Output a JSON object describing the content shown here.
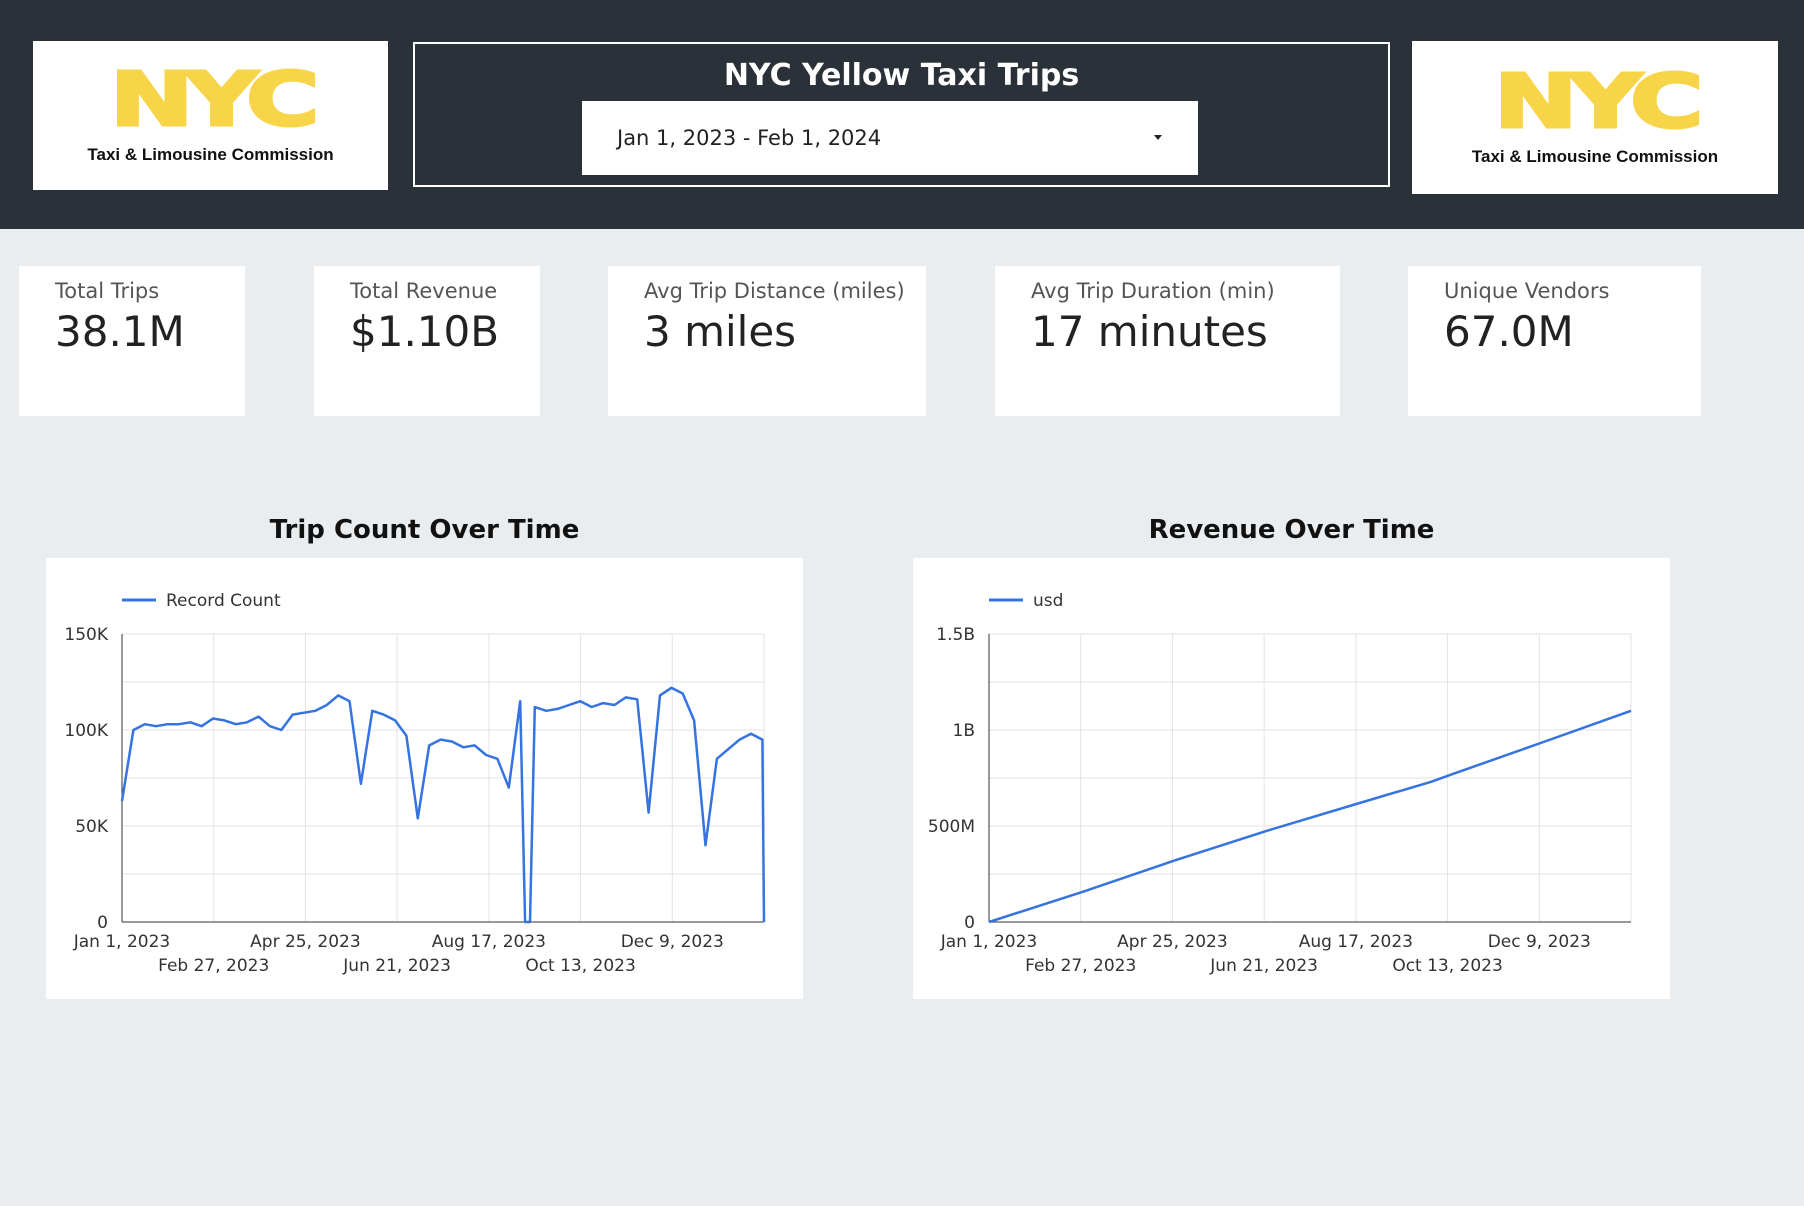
{
  "header": {
    "title": "NYC Yellow Taxi Trips",
    "date_range": "Jan 1, 2023 - Feb 1, 2024",
    "logo_mark": "NYC",
    "logo_subtitle": "Taxi & Limousine Commission",
    "brand_yellow": "#f7d448",
    "background": "#2a3138"
  },
  "kpis": [
    {
      "label": "Total Trips",
      "value": "38.1M"
    },
    {
      "label": "Total Revenue",
      "value": "$1.10B"
    },
    {
      "label": "Avg Trip Distance (miles)",
      "value": "3 miles"
    },
    {
      "label": "Avg Trip Duration (min)",
      "value": "17 minutes"
    },
    {
      "label": "Unique Vendors",
      "value": "67.0M"
    }
  ],
  "chart_data": [
    {
      "type": "line",
      "title": "Trip Count Over Time",
      "legend": "top-left",
      "grid": true,
      "color": "#3573e0",
      "series": [
        {
          "name": "Record Count"
        }
      ],
      "ylim": [
        0,
        150000
      ],
      "y_ticks": [
        "0",
        "50K",
        "100K",
        "150K"
      ],
      "x_ticks_row1": [
        "Jan 1, 2023",
        "Apr 25, 2023",
        "Aug 17, 2023",
        "Dec 9, 2023"
      ],
      "x_ticks_row2": [
        "Feb 27, 2023",
        "Jun 21, 2023",
        "Oct 13, 2023"
      ],
      "x_range": [
        "2023-01-01",
        "2024-01-31"
      ],
      "points": [
        [
          "2023-01-01",
          63000
        ],
        [
          "2023-01-08",
          100000
        ],
        [
          "2023-01-15",
          103000
        ],
        [
          "2023-01-22",
          102000
        ],
        [
          "2023-01-29",
          103000
        ],
        [
          "2023-02-05",
          103000
        ],
        [
          "2023-02-12",
          104000
        ],
        [
          "2023-02-19",
          102000
        ],
        [
          "2023-02-26",
          106000
        ],
        [
          "2023-03-05",
          105000
        ],
        [
          "2023-03-12",
          103000
        ],
        [
          "2023-03-19",
          104000
        ],
        [
          "2023-03-26",
          107000
        ],
        [
          "2023-04-02",
          102000
        ],
        [
          "2023-04-09",
          100000
        ],
        [
          "2023-04-16",
          108000
        ],
        [
          "2023-04-23",
          109000
        ],
        [
          "2023-04-30",
          110000
        ],
        [
          "2023-05-07",
          113000
        ],
        [
          "2023-05-14",
          118000
        ],
        [
          "2023-05-21",
          115000
        ],
        [
          "2023-05-28",
          72000
        ],
        [
          "2023-06-04",
          110000
        ],
        [
          "2023-06-11",
          108000
        ],
        [
          "2023-06-18",
          105000
        ],
        [
          "2023-06-25",
          97000
        ],
        [
          "2023-07-02",
          54000
        ],
        [
          "2023-07-09",
          92000
        ],
        [
          "2023-07-16",
          95000
        ],
        [
          "2023-07-23",
          94000
        ],
        [
          "2023-07-30",
          91000
        ],
        [
          "2023-08-06",
          92000
        ],
        [
          "2023-08-13",
          87000
        ],
        [
          "2023-08-20",
          85000
        ],
        [
          "2023-08-27",
          70000
        ],
        [
          "2023-09-03",
          115000
        ],
        [
          "2023-09-06",
          0
        ],
        [
          "2023-09-09",
          0
        ],
        [
          "2023-09-12",
          112000
        ],
        [
          "2023-09-19",
          110000
        ],
        [
          "2023-09-26",
          111000
        ],
        [
          "2023-10-03",
          113000
        ],
        [
          "2023-10-10",
          115000
        ],
        [
          "2023-10-17",
          112000
        ],
        [
          "2023-10-24",
          114000
        ],
        [
          "2023-10-31",
          113000
        ],
        [
          "2023-11-07",
          117000
        ],
        [
          "2023-11-14",
          116000
        ],
        [
          "2023-11-21",
          57000
        ],
        [
          "2023-11-28",
          118000
        ],
        [
          "2023-12-05",
          122000
        ],
        [
          "2023-12-12",
          119000
        ],
        [
          "2023-12-19",
          105000
        ],
        [
          "2023-12-26",
          40000
        ],
        [
          "2024-01-02",
          85000
        ],
        [
          "2024-01-09",
          90000
        ],
        [
          "2024-01-16",
          95000
        ],
        [
          "2024-01-23",
          98000
        ],
        [
          "2024-01-30",
          95000
        ],
        [
          "2024-01-31",
          0
        ]
      ]
    },
    {
      "type": "line",
      "title": "Revenue Over Time",
      "legend": "top-left",
      "grid": true,
      "color": "#3573e0",
      "series": [
        {
          "name": "usd"
        }
      ],
      "ylim": [
        0,
        1500000000
      ],
      "y_ticks": [
        "0",
        "500M",
        "1B",
        "1.5B"
      ],
      "x_ticks_row1": [
        "Jan 1, 2023",
        "Apr 25, 2023",
        "Aug 17, 2023",
        "Dec 9, 2023"
      ],
      "x_ticks_row2": [
        "Feb 27, 2023",
        "Jun 21, 2023",
        "Oct 13, 2023"
      ],
      "x_range": [
        "2023-01-01",
        "2024-01-31"
      ],
      "points": [
        [
          "2023-01-01",
          0
        ],
        [
          "2023-02-27",
          155000000
        ],
        [
          "2023-04-25",
          320000000
        ],
        [
          "2023-06-21",
          475000000
        ],
        [
          "2023-08-17",
          620000000
        ],
        [
          "2023-09-30",
          730000000
        ],
        [
          "2023-10-13",
          770000000
        ],
        [
          "2023-12-09",
          940000000
        ],
        [
          "2024-01-31",
          1100000000
        ]
      ]
    }
  ]
}
